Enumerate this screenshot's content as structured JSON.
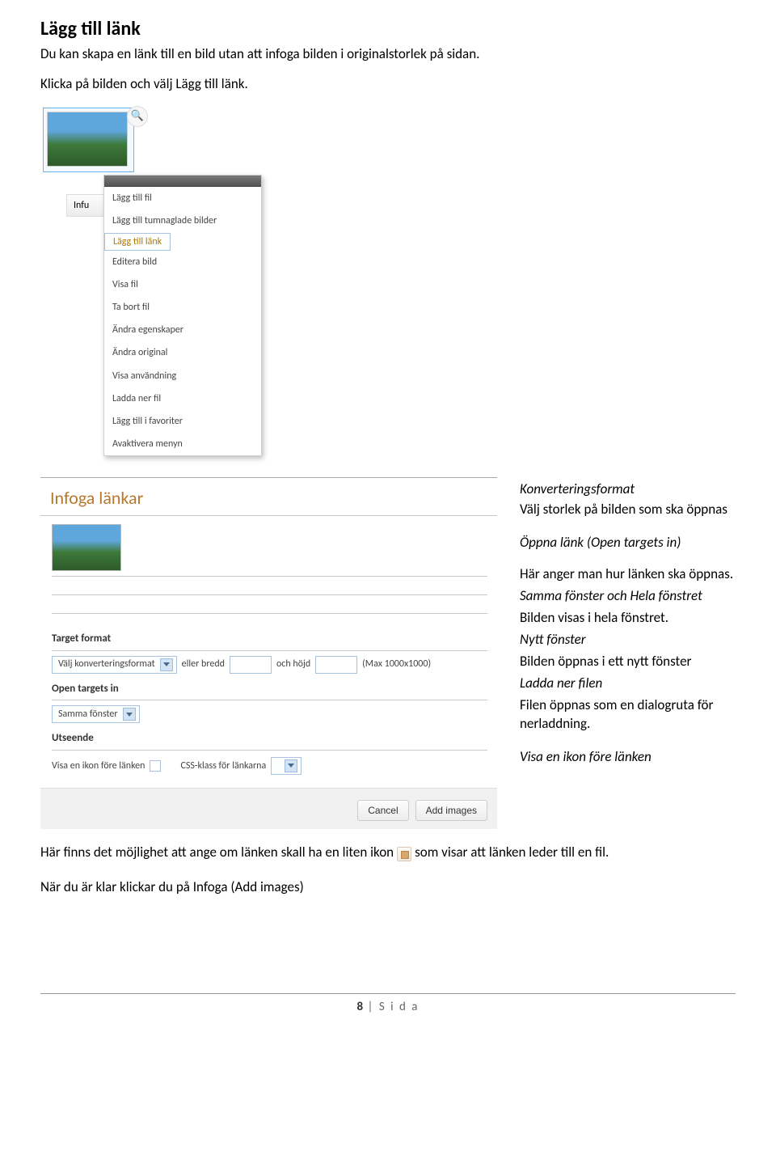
{
  "doc": {
    "title": "Lägg till länk",
    "intro1": "Du kan skapa en länk till en bild utan att infoga bilden i originalstorlek på sidan.",
    "intro2": "Klicka på bilden och välj Lägg till länk."
  },
  "context_menu": {
    "button_label_cut": "Infu",
    "items": [
      "Lägg till fil",
      "Lägg till tumnaglade bilder",
      "Lägg till länk",
      "Editera bild",
      "Visa fil",
      "Ta bort fil",
      "Ändra egenskaper",
      "Ändra original",
      "Visa användning",
      "Ladda ner fil",
      "Lägg till i favoriter",
      "Avaktivera menyn"
    ],
    "selected_index": 2
  },
  "dialog": {
    "title": "Infoga länkar",
    "sections": {
      "target_format": "Target format",
      "open_targets": "Open targets in",
      "appearance": "Utseende"
    },
    "target_row": {
      "select_value": "Välj konverteringsformat",
      "or_width": "eller bredd",
      "and_height": "och höjd",
      "max_note": "(Max 1000x1000)"
    },
    "open_row": {
      "select_value": "Samma fönster"
    },
    "appear_row": {
      "show_icon_label": "Visa en ikon före länken",
      "css_label": "CSS-klass för länkarna"
    },
    "buttons": {
      "cancel": "Cancel",
      "add": "Add images"
    }
  },
  "aside": {
    "konv_h": "Konverteringsformat",
    "konv_t": "Välj storlek på bilden som ska öppnas",
    "open_h": "Öppna länk (Open targets in)",
    "open_t": "Här anger man hur länken ska öppnas.",
    "samma_h": "Samma fönster och Hela fönstret",
    "samma_t": "Bilden visas i hela fönstret.",
    "nytt_h": "Nytt fönster",
    "nytt_t": "Bilden öppnas i ett nytt fönster",
    "ladda_h": "Ladda ner filen",
    "ladda_t": "Filen öppnas som en dialogruta för nerladdning.",
    "visa_h": "Visa en ikon före länken"
  },
  "trail": {
    "pre": "Här finns det möjlighet att ange om länken skall ha en liten ikon",
    "post": "som visar att länken leder till en fil."
  },
  "final": "När du är klar klickar du på Infoga (Add images)",
  "footer": {
    "num": "8",
    "sep": " | ",
    "label": "S i d a"
  }
}
